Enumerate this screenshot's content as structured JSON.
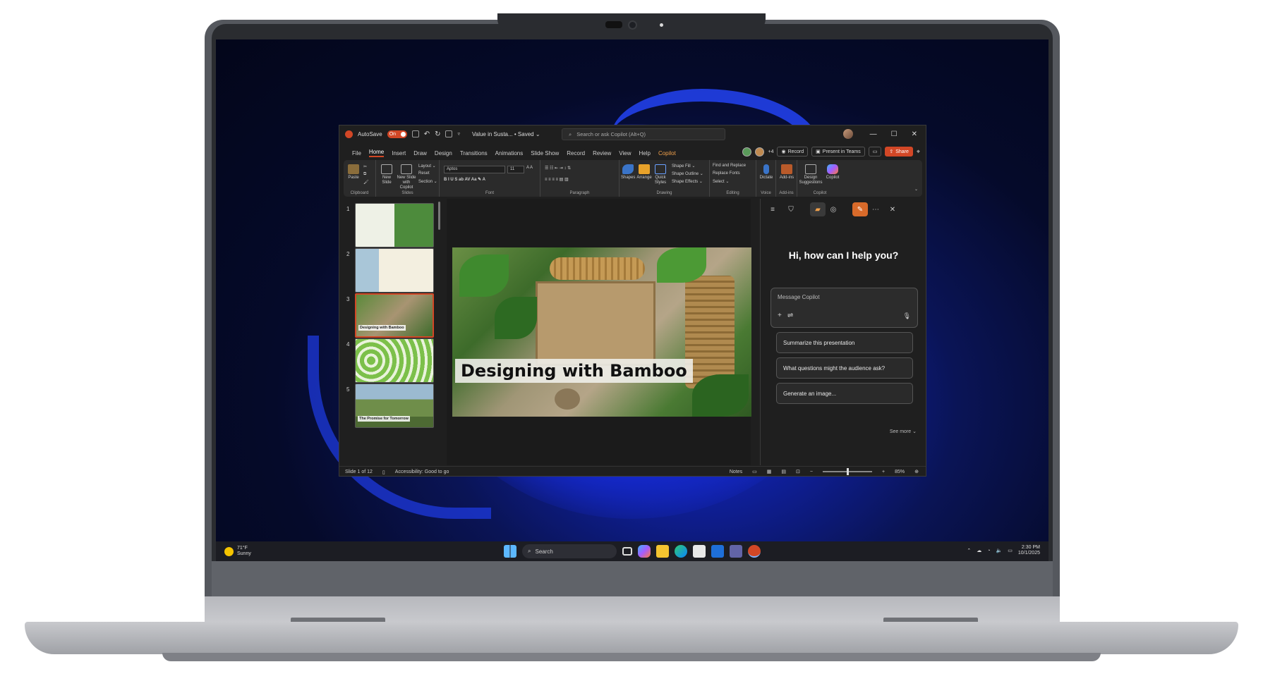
{
  "titlebar": {
    "autosave_label": "AutoSave",
    "autosave_state": "On",
    "doc_title": "Value in Susta... • Saved ⌄",
    "search_placeholder": "Search or ask Copilot (Alt+Q)"
  },
  "menu": {
    "tabs": [
      "File",
      "Home",
      "Insert",
      "Draw",
      "Design",
      "Transitions",
      "Animations",
      "Slide Show",
      "Record",
      "Review",
      "View",
      "Help",
      "Copilot"
    ],
    "active": "Home",
    "collab_count": "+4",
    "record_label": "Record",
    "present_label": "Present in Teams",
    "share_label": "Share"
  },
  "ribbon": {
    "groups": [
      "Clipboard",
      "Slides",
      "Font",
      "Paragraph",
      "Drawing",
      "Editing",
      "Voice",
      "Add-ins",
      "Copilot"
    ],
    "paste": "Paste",
    "new_slide": "New Slide",
    "new_slide_copilot": "New Slide with Copilot",
    "layout": "Layout ⌄",
    "reset": "Reset",
    "section": "Section ⌄",
    "font_name": "Aptos",
    "font_size": "11",
    "shapes": "Shapes",
    "arrange": "Arrange",
    "quick_styles": "Quick Styles",
    "shape_fill": "Shape Fill ⌄",
    "shape_outline": "Shape Outline ⌄",
    "shape_effects": "Shape Effects ⌄",
    "find_replace": "Find and Replace",
    "replace_fonts": "Replace Fonts",
    "select": "Select ⌄",
    "dictate": "Dictate",
    "addins": "Add-ins",
    "design_suggestions": "Design Suggestions",
    "copilot": "Copilot"
  },
  "slides": [
    {
      "num": "1",
      "label": ""
    },
    {
      "num": "2",
      "label": ""
    },
    {
      "num": "3",
      "label": "Designing with Bamboo"
    },
    {
      "num": "4",
      "label": ""
    },
    {
      "num": "5",
      "label": "The Promise for Tomorrow"
    }
  ],
  "slide_title": "Designing with Bamboo",
  "copilot": {
    "greeting": "Hi, how can I help you?",
    "input_placeholder": "Message Copilot",
    "suggestions": [
      "Summarize this presentation",
      "What questions might the audience ask?",
      "Generate an image..."
    ],
    "see_more": "See more ⌄"
  },
  "status": {
    "slide_count": "Slide 1 of 12",
    "accessibility": "Accessibility: Good to go",
    "notes": "Notes",
    "zoom": "85%"
  },
  "taskbar": {
    "temp": "71°F",
    "condition": "Sunny",
    "search_label": "Search",
    "time": "2:30 PM",
    "date": "10/1/2025"
  },
  "colors": {
    "accent": "#d24726",
    "copilot_tab": "#f0a04b"
  }
}
